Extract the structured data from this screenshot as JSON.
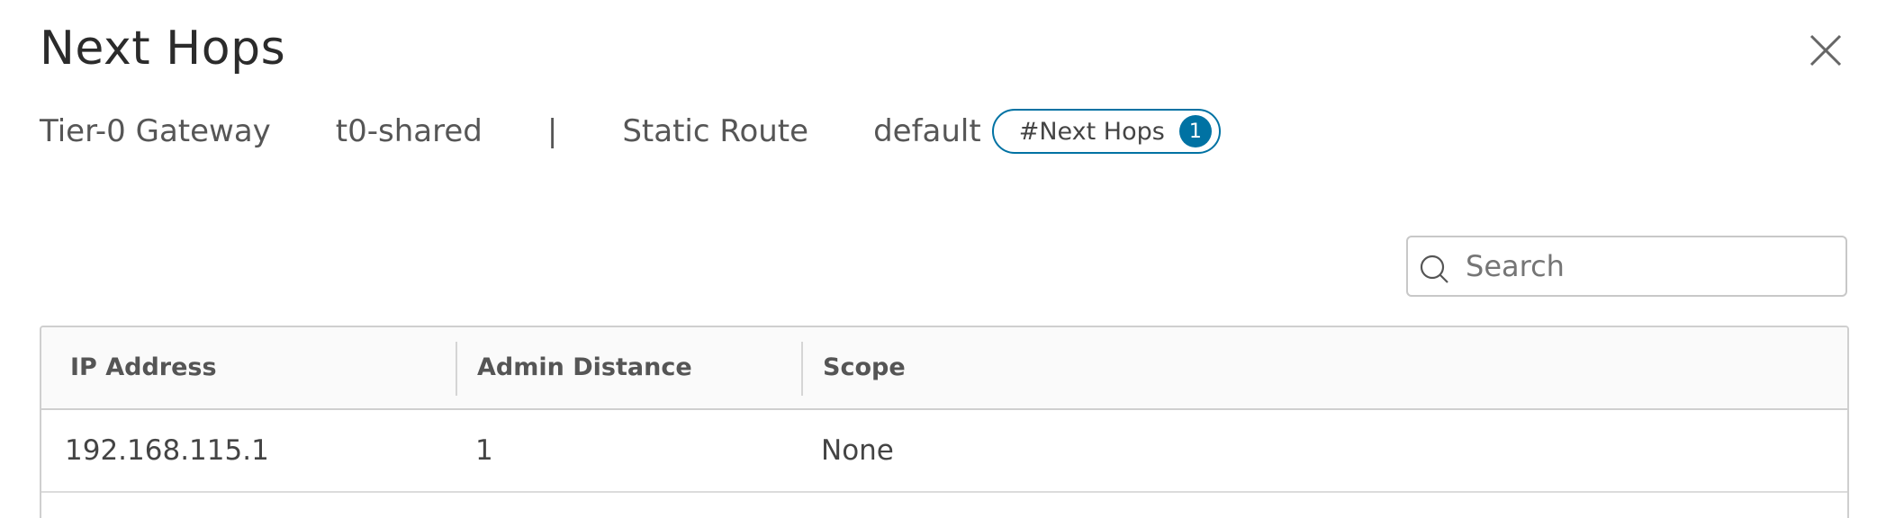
{
  "modal": {
    "title": "Next Hops",
    "close_icon": "close-icon"
  },
  "breadcrumb": {
    "gateway_type": "Tier-0 Gateway",
    "gateway_name": "t0-shared",
    "separator": "|",
    "route_type": "Static Route",
    "route_name": "default",
    "pill_label": "#Next Hops",
    "pill_count": "1"
  },
  "search": {
    "placeholder": "Search",
    "value": "",
    "icon": "search-icon"
  },
  "table": {
    "columns": [
      "IP Address",
      "Admin Distance",
      "Scope"
    ],
    "rows": [
      [
        "192.168.115.1",
        "1",
        "None"
      ]
    ]
  },
  "colors": {
    "accent": "#0072a3",
    "border": "#cfcfcf",
    "header_bg": "#fafafa"
  }
}
